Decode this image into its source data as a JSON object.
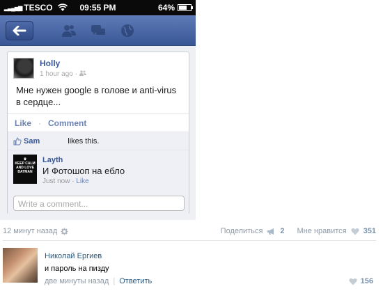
{
  "status_bar": {
    "carrier": "TESCO",
    "time": "09:55 PM",
    "battery": "64%"
  },
  "nav": {
    "icons": [
      "back-arrow-icon",
      "friends-icon",
      "messages-icon",
      "globe-icon"
    ]
  },
  "post": {
    "author": "Holly",
    "time": "1 hour ago ·",
    "text": "Мне нужен google в голове и anti-virus в сердце...",
    "like_label": "Like",
    "dot": "·",
    "comment_label": "Comment",
    "liker": "Sam",
    "likes_text": "likes this."
  },
  "comment": {
    "avatar_text": "KEEP CALM AND LOVE BATMAN",
    "author": "Layth",
    "text": "И Фотошоп на ебло",
    "time": "Just now ·",
    "like": "Like"
  },
  "composer": {
    "placeholder": "Write a comment..."
  },
  "vk_post": {
    "time": "12 минут назад",
    "share_label": "Поделиться",
    "share_count": "2",
    "like_label": "Мне нравится",
    "like_count": "351"
  },
  "vk_comment": {
    "author": "Николай Ергиев",
    "text": "и пароль на пизду",
    "time": "две минуты назад",
    "pipe": "|",
    "reply_label": "Ответить",
    "like_count": "156"
  },
  "colors": {
    "fb_blue": "#3b5998",
    "vk_blue": "#2b587a",
    "vk_gray": "#8f9aa6"
  }
}
